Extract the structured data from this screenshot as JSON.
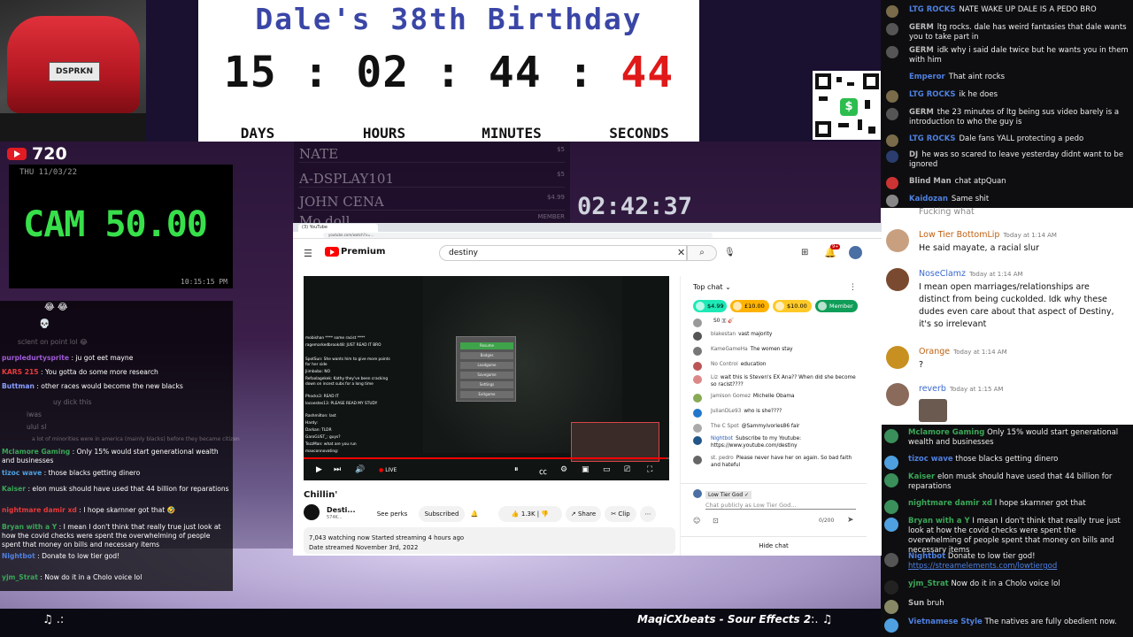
{
  "birthday": {
    "title": "Dale's 38th Birthday",
    "days": "15",
    "hours": "02",
    "minutes": "44",
    "seconds": "44",
    "labels": [
      "DAYS",
      "HOURS",
      "MINUTES",
      "SECONDS"
    ]
  },
  "car": {
    "plate": "DSPRKN"
  },
  "cam": {
    "resolution": "720",
    "date": "THU 11/03/22",
    "value": "CAM 50.00",
    "clock": "10:15:15 PM"
  },
  "stream_clock": "02:42:37",
  "donations": [
    {
      "name": "NATE",
      "amount": "$5"
    },
    {
      "name": "A-DSPLAY101",
      "amount": "$5"
    },
    {
      "name": "JOHN CENA",
      "amount": "$4.99"
    },
    {
      "name": "Mo doll",
      "amount": "MEMBER"
    }
  ],
  "music": {
    "left": "♫ .:",
    "track": "MaqiCXbeats - Sour Effects 2",
    "end": ":. ♫"
  },
  "chat_top": [
    {
      "name": "LTG ROCKS",
      "color": "#4f80e0",
      "msg": "NATE WAKE UP DALE IS A PEDO BRO"
    },
    {
      "name": "GERM",
      "color": "#aaaaaa",
      "msg": "ltg rocks. dale has weird fantasies that dale wants you to take part in"
    },
    {
      "name": "GERM",
      "color": "#aaaaaa",
      "msg": "idk why i said dale twice but he wants you in them with him"
    },
    {
      "name": "Emperor",
      "color": "#4f80e0",
      "msg": "That aint rocks"
    },
    {
      "name": "LTG ROCKS",
      "color": "#4f80e0",
      "msg": "ik he does"
    },
    {
      "name": "GERM",
      "color": "#aaaaaa",
      "msg": "the 23 minutes of ltg being sus video barely is a introduction to who the guy is"
    },
    {
      "name": "LTG ROCKS",
      "color": "#4f80e0",
      "msg": "Dale fans YALL protecting a pedo"
    },
    {
      "name": "DJ",
      "color": "#aaaaaa",
      "msg": "he was so scared to leave yesterday didnt want to be ignored"
    },
    {
      "name": "Blind Man",
      "color": "#aaaaaa",
      "msg": "chat atpQuan"
    },
    {
      "name": "Kaidozan",
      "color": "#4f80e0",
      "msg": "Same shit"
    }
  ],
  "yt_white_chat": [
    {
      "name": "",
      "time": "",
      "msg": "Fucking what"
    },
    {
      "name": "Low Tier BottomLip",
      "time": "Today at 1:14 AM",
      "msg": "He said mayate, a racial slur"
    },
    {
      "name": "NoseClamz",
      "time": "Today at 1:14 AM",
      "msg": "I mean open marriages/relationships are distinct from being cuckolded.  Idk why these dudes even care about that aspect of Destiny, it's so irrelevant"
    },
    {
      "name": "Orange",
      "time": "Today at 1:14 AM",
      "msg": "?"
    },
    {
      "name": "reverb",
      "time": "Today at 1:15 AM",
      "msg": ""
    }
  ],
  "chat_bottom": [
    {
      "name": "Mclamore Gaming",
      "color": "#3aa757",
      "msg": "Only 15% would start generational wealth and businesses"
    },
    {
      "name": "tizoc wave",
      "color": "#4f80e0",
      "msg": "those blacks getting dinero"
    },
    {
      "name": "Kaiser",
      "color": "#3aa757",
      "msg": "elon musk should have used that 44 billion for reparations"
    },
    {
      "name": "nightmare damir xd",
      "color": "#3aa757",
      "msg": "I hope skarnner got that"
    },
    {
      "name": "Bryan with a Y",
      "color": "#3aa757",
      "msg": "I mean I don't think that really true just look at how the covid checks were spent the overwhelming of people spent that money on bills and necessary items"
    },
    {
      "name": "Nightbot",
      "color": "#4f80e0",
      "msg": "Donate to low tier god!",
      "link": "https://streamelements.com/lowtiergod"
    },
    {
      "name": "yjm_Strat",
      "color": "#3aa757",
      "msg": "Now do it in a Cholo voice lol"
    },
    {
      "name": "Sun",
      "color": "#aaaaaa",
      "msg": "bruh"
    },
    {
      "name": "Vietnamese Style",
      "color": "#4f80e0",
      "msg": "The natives are fully obedient now."
    }
  ],
  "left_chat": [
    {
      "name": "",
      "msg": "😂 😂",
      "faded": false
    },
    {
      "name": "",
      "msg": "💀",
      "faded": false
    },
    {
      "name": "",
      "msg": "sclent on point lol 😂",
      "faded": true
    },
    {
      "name": "purpledurtysprite",
      "msg": "ju got eet mayne",
      "faded": false
    },
    {
      "name": "KARS 215",
      "msg": "You gotta do some more research",
      "faded": false
    },
    {
      "name": "Buttman",
      "msg": "other races would become the new blacks",
      "faded": false
    },
    {
      "name": "",
      "msg": "uy dick this",
      "faded": true
    },
    {
      "name": "",
      "msg": "iwas",
      "faded": true
    },
    {
      "name": "",
      "msg": "ulul sl",
      "faded": true
    },
    {
      "name": "",
      "msg": "a lot of minorities were in america (mainly blacks) before they became citizen",
      "faded": true
    },
    {
      "name": "Mclamore Gaming",
      "msg": "Only 15% would start generational wealth and businesses",
      "faded": false
    },
    {
      "name": "tizoc wave",
      "msg": "those blacks getting dinero",
      "faded": false
    },
    {
      "name": "Kaiser",
      "msg": "elon musk should have used that 44 billion for reparations",
      "faded": false
    },
    {
      "name": "nightmare damir xd",
      "msg": "I hope skarnner got that 🤣",
      "faded": false
    },
    {
      "name": "Bryan with a Y",
      "msg": "I mean I don't think that really true just look at how the covid checks were spent the overwhelming of people spent that money on bills and necessary items",
      "faded": false
    },
    {
      "name": "Nightbot",
      "msg": "Donate to low tier god!",
      "faded": false
    },
    {
      "name": "yjm_Strat",
      "msg": "Now do it in a Cholo voice lol",
      "faded": false
    }
  ],
  "browser": {
    "tab": "(3) YouTube",
    "url": "youtube.com/watch?v=...",
    "search_value": "destiny",
    "premium": "Premium",
    "notif_count": "9+",
    "video_title": "Chillin'",
    "channel": "Desti...",
    "subs": "574K...",
    "see_perks": "See perks",
    "subscribed": "Subscribed",
    "likes": "1.3K",
    "share": "Share",
    "clip": "Clip",
    "meta1": "7,043 watching now  Started streaming 4 hours ago",
    "meta2": "Date streamed November 3rd, 2022",
    "live_label": "LIVE",
    "menu_items": [
      "Resume",
      "Badges",
      "Loadgame",
      "Savegame",
      "Settings",
      "Exitgame"
    ],
    "video_chat": [
      "mobishan **** some racist ****",
      "ragemarkedbrook48: JUST READ IT BRO",
      "SpotSun: She wants him to give more points for her side",
      "Jiimbobo: NO",
      "Refoolagekek: Kathy they've been cracking down on incest subs for a long time",
      "Phocks3: READ IT",
      "locoestes13: PLEASE READ MY STUDY",
      "Rashmilton: last",
      "Hardy:",
      "Darkan: TLDR",
      "GaroGUST_: guys?",
      "TezzMan: what are you run",
      "maxconnovating:"
    ]
  },
  "live_chat": {
    "title": "Top chat",
    "superchats": [
      {
        "label": "$4.99",
        "color": "#1de9b6"
      },
      {
        "label": "£10.00",
        "color": "#ffb300"
      },
      {
        "label": "$10.00",
        "color": "#ffca28"
      },
      {
        "label": "Member",
        "color": "#0f9d58"
      }
    ],
    "messages": [
      {
        "name": "",
        "msg": "S0 🇽 🎸",
        "color": "#999"
      },
      {
        "name": "blakestan",
        "msg": "vast majority",
        "color": "#555"
      },
      {
        "name": "KameGameHa",
        "msg": "The women stay",
        "color": "#777"
      },
      {
        "name": "No Control",
        "msg": "education",
        "color": "#b55"
      },
      {
        "name": "Liz",
        "msg": "wait this is Steven's EX Ana?? When did she become so racist????",
        "color": "#d88"
      },
      {
        "name": "Jamison Gomez",
        "msg": "Michelle Obama",
        "color": "#8a5"
      },
      {
        "name": "JulianDLe93",
        "msg": "who is she????",
        "color": "#27c"
      },
      {
        "name": "The C Spot",
        "msg": "@Sammyivories86 fair",
        "color": "#aaa"
      },
      {
        "name": "Nightbot",
        "msg": "Subscribe to my Youtube: https://www.youtube.com/destiny",
        "color": "#258"
      },
      {
        "name": "st. pedro",
        "msg": "Please never have her on again. So bad faith and hateful",
        "color": "#666"
      }
    ],
    "user_chip": "Low Tier God ✓",
    "placeholder": "Chat publicly as Low Tier God...",
    "count": "0/200",
    "hide": "Hide chat"
  }
}
